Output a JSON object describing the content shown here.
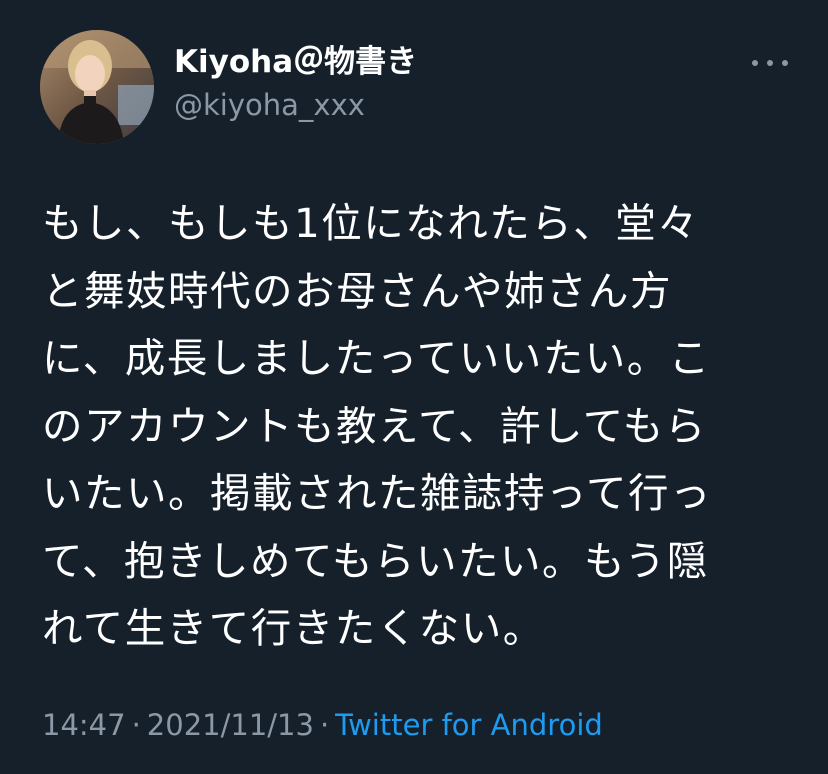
{
  "author": {
    "display_name": "Kiyoha＠物書き",
    "handle": "@kiyoha_xxx"
  },
  "more_icon": "more-horizontal-icon",
  "tweet": {
    "lines": [
      "もし、もしも1位になれたら、堂々",
      "と舞妓時代のお母さんや姉さん方",
      "に、成長しましたっていいたい。こ",
      "のアカウントも教えて、許してもら",
      "いたい。掲載された雑誌持って行っ",
      "て、抱きしめてもらいたい。もう隠",
      "れて生きて行きたくない。"
    ]
  },
  "meta": {
    "time": "14:47",
    "separator": "·",
    "date": "2021/11/13",
    "source": "Twitter for Android"
  },
  "colors": {
    "background": "#15202b",
    "text": "#ffffff",
    "secondary": "#8b98a5",
    "link": "#1d9bf0"
  }
}
